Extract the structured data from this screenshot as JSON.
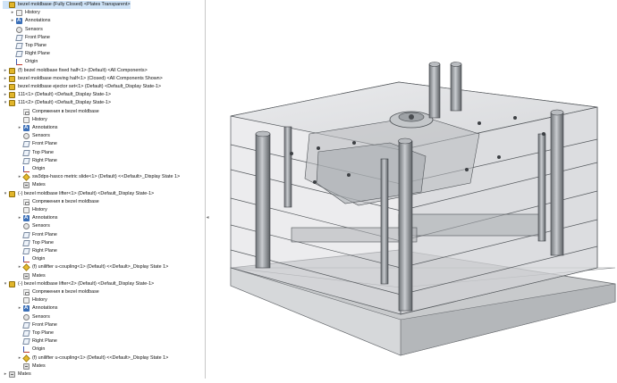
{
  "feature_tree": {
    "root": "bezel moldbase (Fully Closed) <Plates Transparent>",
    "items": [
      {
        "label": "History",
        "icon": "history-icon",
        "indent": 1,
        "toggle": "▸"
      },
      {
        "label": "Annotations",
        "icon": "annotations-icon",
        "indent": 1,
        "toggle": "▸"
      },
      {
        "label": "Sensors",
        "icon": "sensors-icon",
        "indent": 1,
        "toggle": ""
      },
      {
        "label": "Front Plane",
        "icon": "plane-icon",
        "indent": 1,
        "toggle": ""
      },
      {
        "label": "Top Plane",
        "icon": "plane-icon",
        "indent": 1,
        "toggle": ""
      },
      {
        "label": "Right Plane",
        "icon": "plane-icon",
        "indent": 1,
        "toggle": ""
      },
      {
        "label": "Origin",
        "icon": "origin-icon",
        "indent": 1,
        "toggle": ""
      },
      {
        "label": "(f) bezel moldbase fixed half<1> (Default) <All Components>",
        "icon": "subassembly-icon",
        "indent": 0,
        "toggle": "▸"
      },
      {
        "label": "bezel moldbase moving half<1> (Closed) <All Components Shown>",
        "icon": "subassembly-icon",
        "indent": 0,
        "toggle": "▸"
      },
      {
        "label": "bezel moldbase ejector set<1> (Default) <Default_Display State-1>",
        "icon": "subassembly-icon",
        "indent": 0,
        "toggle": "▸"
      },
      {
        "label": "111<1> (Default) <Default_Display State-1>",
        "icon": "subassembly-icon",
        "indent": 0,
        "toggle": "▸"
      },
      {
        "label": "111<2> (Default) <Default_Display State-1>",
        "icon": "subassembly-icon",
        "indent": 0,
        "toggle": "▾"
      },
      {
        "label": "Сопряжения в bezel moldbase",
        "icon": "mate-icon",
        "indent": 2,
        "toggle": ""
      },
      {
        "label": "History",
        "icon": "history-icon",
        "indent": 2,
        "toggle": ""
      },
      {
        "label": "Annotations",
        "icon": "annotations-icon",
        "indent": 2,
        "toggle": "▸"
      },
      {
        "label": "Sensors",
        "icon": "sensors-icon",
        "indent": 2,
        "toggle": ""
      },
      {
        "label": "Front Plane",
        "icon": "plane-icon",
        "indent": 2,
        "toggle": ""
      },
      {
        "label": "Top Plane",
        "icon": "plane-icon",
        "indent": 2,
        "toggle": ""
      },
      {
        "label": "Right Plane",
        "icon": "plane-icon",
        "indent": 2,
        "toggle": ""
      },
      {
        "label": "Origin",
        "icon": "origin-icon",
        "indent": 2,
        "toggle": ""
      },
      {
        "label": "sw3dps-hasco metric slide<1> (Default) <<Default>_Display State 1>",
        "icon": "part-icon",
        "indent": 2,
        "toggle": "▸"
      },
      {
        "label": "Mates",
        "icon": "mates-icon",
        "indent": 2,
        "toggle": ""
      },
      {
        "label": "(-) bezel moldbase lifter<1> (Default) <Default_Display State-1>",
        "icon": "subassembly-icon",
        "indent": 0,
        "toggle": "▾"
      },
      {
        "label": "Сопряжения в bezel moldbase",
        "icon": "mate-icon",
        "indent": 2,
        "toggle": ""
      },
      {
        "label": "History",
        "icon": "history-icon",
        "indent": 2,
        "toggle": ""
      },
      {
        "label": "Annotations",
        "icon": "annotations-icon",
        "indent": 2,
        "toggle": "▸"
      },
      {
        "label": "Sensors",
        "icon": "sensors-icon",
        "indent": 2,
        "toggle": ""
      },
      {
        "label": "Front Plane",
        "icon": "plane-icon",
        "indent": 2,
        "toggle": ""
      },
      {
        "label": "Top Plane",
        "icon": "plane-icon",
        "indent": 2,
        "toggle": ""
      },
      {
        "label": "Right Plane",
        "icon": "plane-icon",
        "indent": 2,
        "toggle": ""
      },
      {
        "label": "Origin",
        "icon": "origin-icon",
        "indent": 2,
        "toggle": ""
      },
      {
        "label": "(f) unilifter u-coupling<1> (Default) <<Default>_Display State 1>",
        "icon": "part-icon",
        "indent": 2,
        "toggle": "▸"
      },
      {
        "label": "Mates",
        "icon": "mates-icon",
        "indent": 2,
        "toggle": ""
      },
      {
        "label": "(-) bezel moldbase lifter<2> (Default) <Default_Display State-1>",
        "icon": "subassembly-icon",
        "indent": 0,
        "toggle": "▾"
      },
      {
        "label": "Сопряжения в bezel moldbase",
        "icon": "mate-icon",
        "indent": 2,
        "toggle": ""
      },
      {
        "label": "History",
        "icon": "history-icon",
        "indent": 2,
        "toggle": ""
      },
      {
        "label": "Annotations",
        "icon": "annotations-icon",
        "indent": 2,
        "toggle": "▸"
      },
      {
        "label": "Sensors",
        "icon": "sensors-icon",
        "indent": 2,
        "toggle": ""
      },
      {
        "label": "Front Plane",
        "icon": "plane-icon",
        "indent": 2,
        "toggle": ""
      },
      {
        "label": "Top Plane",
        "icon": "plane-icon",
        "indent": 2,
        "toggle": ""
      },
      {
        "label": "Right Plane",
        "icon": "plane-icon",
        "indent": 2,
        "toggle": ""
      },
      {
        "label": "Origin",
        "icon": "origin-icon",
        "indent": 2,
        "toggle": ""
      },
      {
        "label": "(f) unilifter u-coupling<1> (Default) <<Default>_Display State 1>",
        "icon": "part-icon",
        "indent": 2,
        "toggle": "▸"
      },
      {
        "label": "Mates",
        "icon": "mates-icon",
        "indent": 2,
        "toggle": ""
      },
      {
        "label": "Mates",
        "icon": "mates-icon",
        "indent": 0,
        "toggle": "▸"
      }
    ]
  },
  "panel_toggle": "◂",
  "viewport": {
    "description_color": "#9aa0a6"
  }
}
